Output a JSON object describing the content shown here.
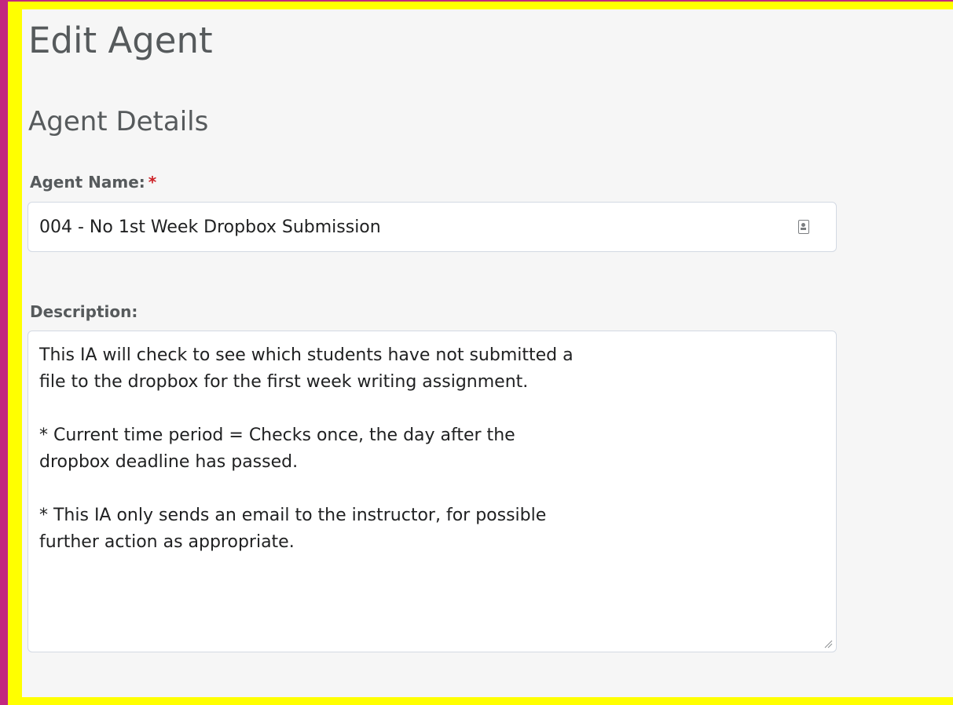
{
  "page": {
    "title": "Edit Agent"
  },
  "agent_details": {
    "section_title": "Agent Details",
    "name_label": "Agent Name:",
    "required_marker": "*",
    "name_value": "004 - No 1st Week Dropbox Submission",
    "description_label": "Description:",
    "description_value": "This IA will check to see which students have not submitted a\nfile to the dropbox for the first week writing assignment.\n\n* Current time period = Checks once, the day after the\ndropbox deadline has passed.\n\n* This IA only sends an email to the instructor, for possible\nfurther action as appropriate."
  },
  "icons": {
    "name_field_icon": "contact-card-icon",
    "textarea_grip": "resize-grip-icon"
  },
  "colors": {
    "outer_background": "#c2287f",
    "frame": "#ffff00",
    "panel": "#f6f6f6",
    "required": "#cd2026",
    "heading_text": "#565a5c"
  }
}
